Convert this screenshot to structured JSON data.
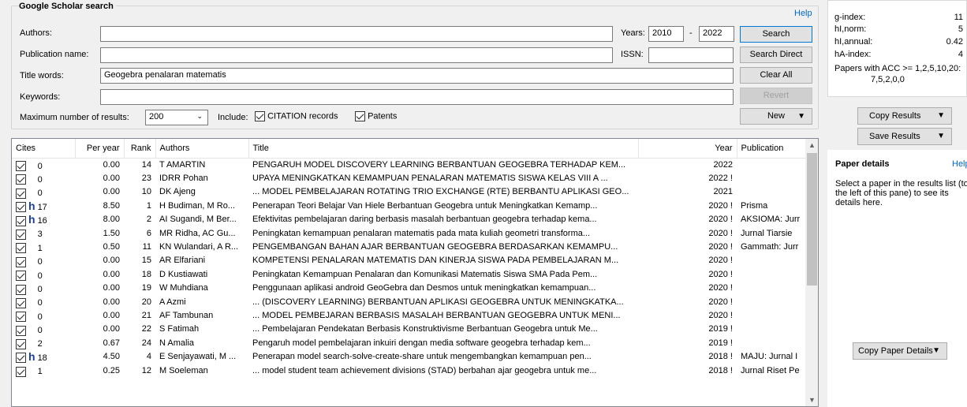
{
  "search": {
    "group_title": "Google Scholar search",
    "help": "Help",
    "authors_label": "Authors:",
    "authors_value": "",
    "pubname_label": "Publication name:",
    "pubname_value": "",
    "title_label": "Title words:",
    "title_value": "Geogebra penalaran matematis",
    "keywords_label": "Keywords:",
    "keywords_value": "",
    "years_label": "Years:",
    "year_from": "2010",
    "year_dash": "-",
    "year_to": "2022",
    "issn_label": "ISSN:",
    "issn_value": "",
    "maxres_label": "Maximum number of results:",
    "maxres_value": "200",
    "include_label": "Include:",
    "citation_label": "CITATION records",
    "patents_label": "Patents",
    "buttons": {
      "search": "Search",
      "search_direct": "Search Direct",
      "clear_all": "Clear All",
      "revert": "Revert",
      "new": "New"
    }
  },
  "table": {
    "headers": [
      "Cites",
      "Per year",
      "Rank",
      "Authors",
      "Title",
      "Year",
      "Publication"
    ],
    "rows": [
      {
        "h": false,
        "cites": "0",
        "peryear": "0.00",
        "rank": "14",
        "authors": "T AMARTIN",
        "title": "PENGARUH MODEL DISCOVERY LEARNING BERBANTUAN GEOGEBRA TERHADAP KEM...",
        "year": "2022",
        "pub": ""
      },
      {
        "h": false,
        "cites": "0",
        "peryear": "0.00",
        "rank": "23",
        "authors": "IDRR Pohan",
        "title": "UPAYA MENINGKATKAN KEMAMPUAN PENALARAN MATEMATIS SISWA KELAS VIII A ...",
        "year": "2022 !",
        "pub": ""
      },
      {
        "h": false,
        "cites": "0",
        "peryear": "0.00",
        "rank": "10",
        "authors": "DK Ajeng",
        "title": "... MODEL PEMBELAJARAN ROTATING TRIO EXCHANGE (RTE) BERBANTU APLIKASI GEO...",
        "year": "2021",
        "pub": ""
      },
      {
        "h": true,
        "cites": "17",
        "peryear": "8.50",
        "rank": "1",
        "authors": "H Budiman, M Ro...",
        "title": "Penerapan Teori Belajar Van Hiele Berbantuan Geogebra untuk Meningkatkan Kemamp...",
        "year": "2020 !",
        "pub": "Prisma"
      },
      {
        "h": true,
        "cites": "16",
        "peryear": "8.00",
        "rank": "2",
        "authors": "AI Sugandi, M Ber...",
        "title": "Efektivitas pembelajaran daring berbasis masalah berbantuan geogebra terhadap kema...",
        "year": "2020 !",
        "pub": "AKSIOMA: Jurr"
      },
      {
        "h": false,
        "cites": "3",
        "peryear": "1.50",
        "rank": "6",
        "authors": "MR Ridha, AC Gu...",
        "title": "Peningkatan kemampuan penalaran matematis pada mata kuliah geometri transforma...",
        "year": "2020 !",
        "pub": "Jurnal Tiarsie"
      },
      {
        "h": false,
        "cites": "1",
        "peryear": "0.50",
        "rank": "11",
        "authors": "KN Wulandari, A R...",
        "title": "PENGEMBANGAN BAHAN AJAR BERBANTUAN GEOGEBRA BERDASARKAN KEMAMPU...",
        "year": "2020 !",
        "pub": "Gammath: Jurr"
      },
      {
        "h": false,
        "cites": "0",
        "peryear": "0.00",
        "rank": "15",
        "authors": "AR Elfariani",
        "title": "KOMPETENSI PENALARAN MATEMATIS DAN KINERJA SISWA PADA PEMBELAJARAN M...",
        "year": "2020 !",
        "pub": ""
      },
      {
        "h": false,
        "cites": "0",
        "peryear": "0.00",
        "rank": "18",
        "authors": "D Kustiawati",
        "title": "Peningkatan Kemampuan Penalaran dan Komunikasi Matematis Siswa SMA Pada Pem...",
        "year": "2020 !",
        "pub": ""
      },
      {
        "h": false,
        "cites": "0",
        "peryear": "0.00",
        "rank": "19",
        "authors": "W Muhdiana",
        "title": "Penggunaan aplikasi android GeoGebra dan Desmos untuk meningkatkan kemampuan...",
        "year": "2020 !",
        "pub": ""
      },
      {
        "h": false,
        "cites": "0",
        "peryear": "0.00",
        "rank": "20",
        "authors": "A Azmi",
        "title": "... (DISCOVERY LEARNING) BERBANTUAN APLIKASI GEOGEBRA UNTUK MENINGKATKA...",
        "year": "2020 !",
        "pub": ""
      },
      {
        "h": false,
        "cites": "0",
        "peryear": "0.00",
        "rank": "21",
        "authors": "AF Tambunan",
        "title": "... MODEL PEMBEJARAN BERBASIS MASALAH BERBANTUAN GEOGEBRA UNTUK MENI...",
        "year": "2020 !",
        "pub": ""
      },
      {
        "h": false,
        "cites": "0",
        "peryear": "0.00",
        "rank": "22",
        "authors": "S Fatimah",
        "title": "... Pembelajaran Pendekatan Berbasis Konstruktivisme Berbantuan Geogebra untuk Me...",
        "year": "2019 !",
        "pub": ""
      },
      {
        "h": false,
        "cites": "2",
        "peryear": "0.67",
        "rank": "24",
        "authors": "N Amalia",
        "title": "Pengaruh model pembelajaran inkuiri dengan media software geogebra terhadap kem...",
        "year": "2019 !",
        "pub": ""
      },
      {
        "h": true,
        "cites": "18",
        "peryear": "4.50",
        "rank": "4",
        "authors": "E Senjayawati, M ...",
        "title": "Penerapan model search-solve-create-share untuk mengembangkan kemampuan pen...",
        "year": "2018 !",
        "pub": "MAJU: Jurnal I"
      },
      {
        "h": false,
        "cites": "1",
        "peryear": "0.25",
        "rank": "12",
        "authors": "M Soeleman",
        "title": "... model student team achievement divisions (STAD) berbahan ajar geogebra untuk me...",
        "year": "2018 !",
        "pub": "Jurnal Riset Pe"
      }
    ]
  },
  "metrics": {
    "rows": [
      {
        "label": "g-index:",
        "value": "11"
      },
      {
        "label": "hI,norm:",
        "value": "5"
      },
      {
        "label": "hI,annual:",
        "value": "0.42"
      },
      {
        "label": "hA-index:",
        "value": "4"
      }
    ],
    "acc_label": "Papers with ACC >= 1,2,5,10,20:",
    "acc_value": "7,5,2,0,0",
    "copy_results": "Copy Results",
    "save_results": "Save Results"
  },
  "details": {
    "title": "Paper details",
    "help": "Help",
    "text": "Select a paper in the results list (to the left of this pane) to see its details here.",
    "copy_details": "Copy Paper Details"
  }
}
